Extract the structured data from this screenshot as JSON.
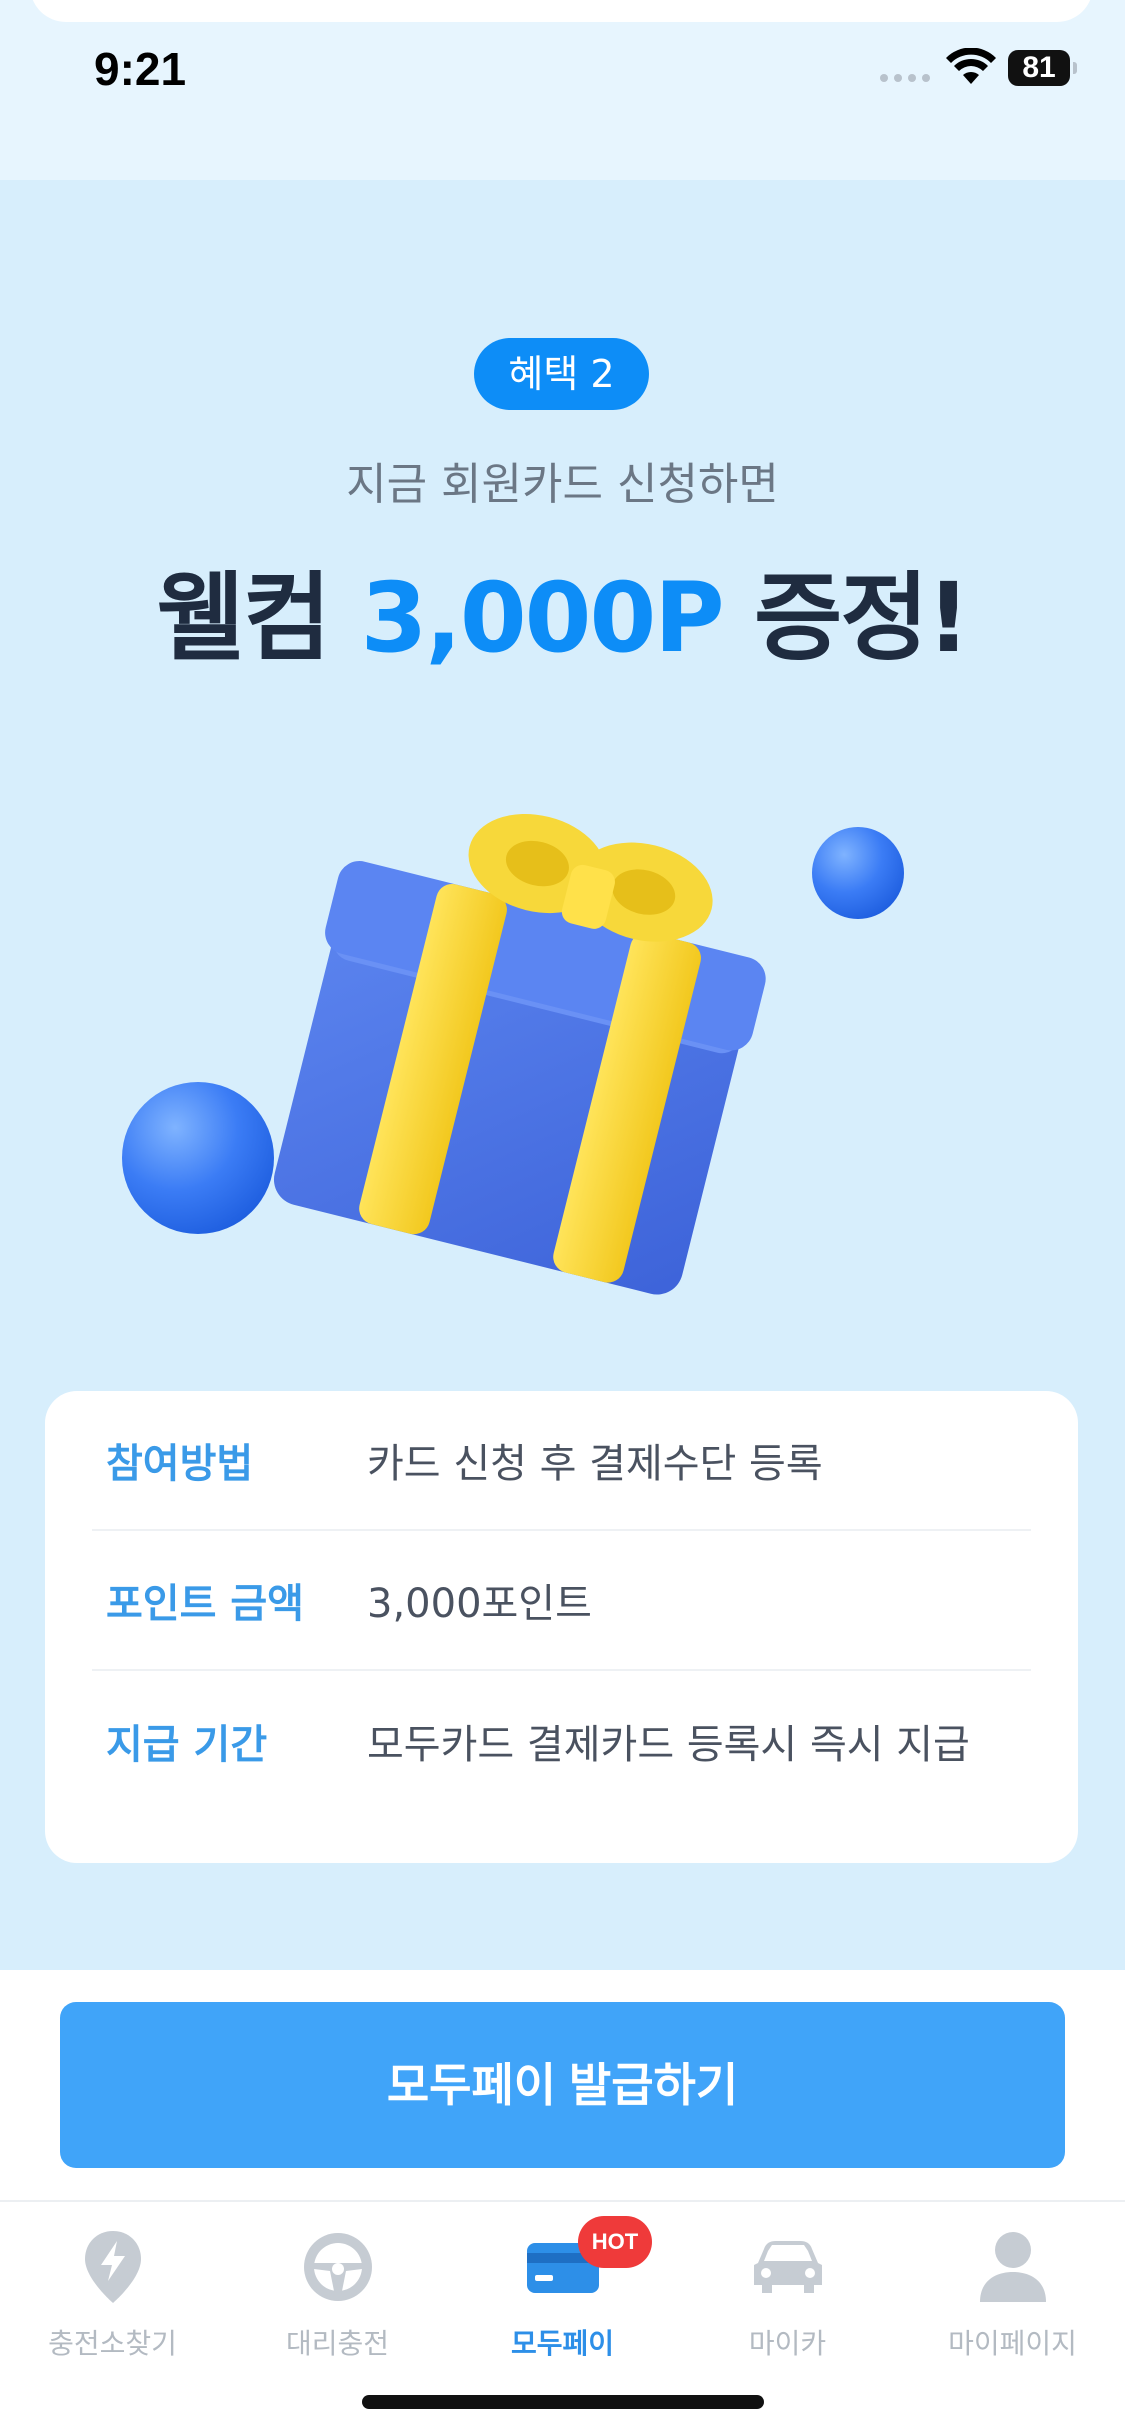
{
  "status_bar": {
    "time": "9:21",
    "battery": "81"
  },
  "hero": {
    "badge": "혜택 2",
    "subtitle": "지금 회원카드 신청하면",
    "headline_prefix": "웰컴 ",
    "headline_accent": "3,000P",
    "headline_suffix": " 증정!"
  },
  "info": {
    "rows": [
      {
        "label": "참여방법",
        "value": "카드 신청 후 결제수단 등록"
      },
      {
        "label": "포인트 금액",
        "value": "3,000포인트"
      },
      {
        "label": "지급 기간",
        "value": "모두카드 결제카드 등록시 즉시 지급"
      }
    ]
  },
  "cta": {
    "label": "모두페이 발급하기"
  },
  "tabbar": {
    "tabs": [
      {
        "label": "충전소찾기",
        "icon": "location-bolt-icon"
      },
      {
        "label": "대리충전",
        "icon": "steering-wheel-icon"
      },
      {
        "label": "모두페이",
        "icon": "card-icon",
        "badge": "HOT"
      },
      {
        "label": "마이카",
        "icon": "car-icon"
      },
      {
        "label": "마이페이지",
        "icon": "person-icon"
      }
    ]
  },
  "colors": {
    "accent": "#0d8df7",
    "cta": "#40a4f9",
    "background": "#d7eefc",
    "hot": "#ef3a3a"
  }
}
